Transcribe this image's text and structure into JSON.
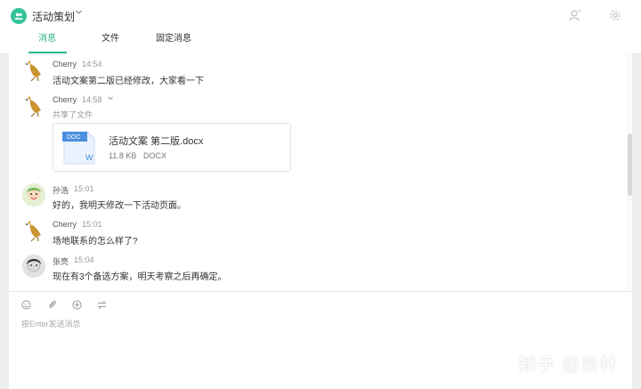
{
  "header": {
    "group_name": "活动策划",
    "tabs": [
      {
        "label": "消息",
        "active": true
      },
      {
        "label": "文件",
        "active": false
      },
      {
        "label": "固定消息",
        "active": false
      }
    ],
    "icons": [
      "member-icon",
      "settings-icon"
    ]
  },
  "messages": [
    {
      "sender": "Cherry",
      "time": "14:54",
      "text": "活动文案第二版已经修改，大家看一下",
      "avatar": "duck"
    },
    {
      "sender": "Cherry",
      "time": "14:58",
      "sub": "共享了文件",
      "avatar": "duck",
      "file": {
        "badge": "DOC",
        "letter": "W",
        "name": "活动文案 第二版.docx",
        "size": "11.8 KB",
        "type": "DOCX"
      }
    },
    {
      "sender": "孙浩",
      "time": "15:01",
      "text": "好的，我明天修改一下活动页面。",
      "avatar": "sun"
    },
    {
      "sender": "Cherry",
      "time": "15:01",
      "text": "场地联系的怎么样了?",
      "avatar": "duck"
    },
    {
      "sender": "张亮",
      "time": "15:04",
      "text": "现在有3个备选方案，明天考察之后再确定。",
      "avatar": "zhang"
    }
  ],
  "composer": {
    "placeholder": "按Enter发送消息",
    "tools": [
      "emoji-icon",
      "attachment-icon",
      "add-icon",
      "swap-icon"
    ]
  },
  "watermark": "知乎 @袁林",
  "colors": {
    "accent": "#2fb58d",
    "file_blue": "#4a8fe0"
  }
}
